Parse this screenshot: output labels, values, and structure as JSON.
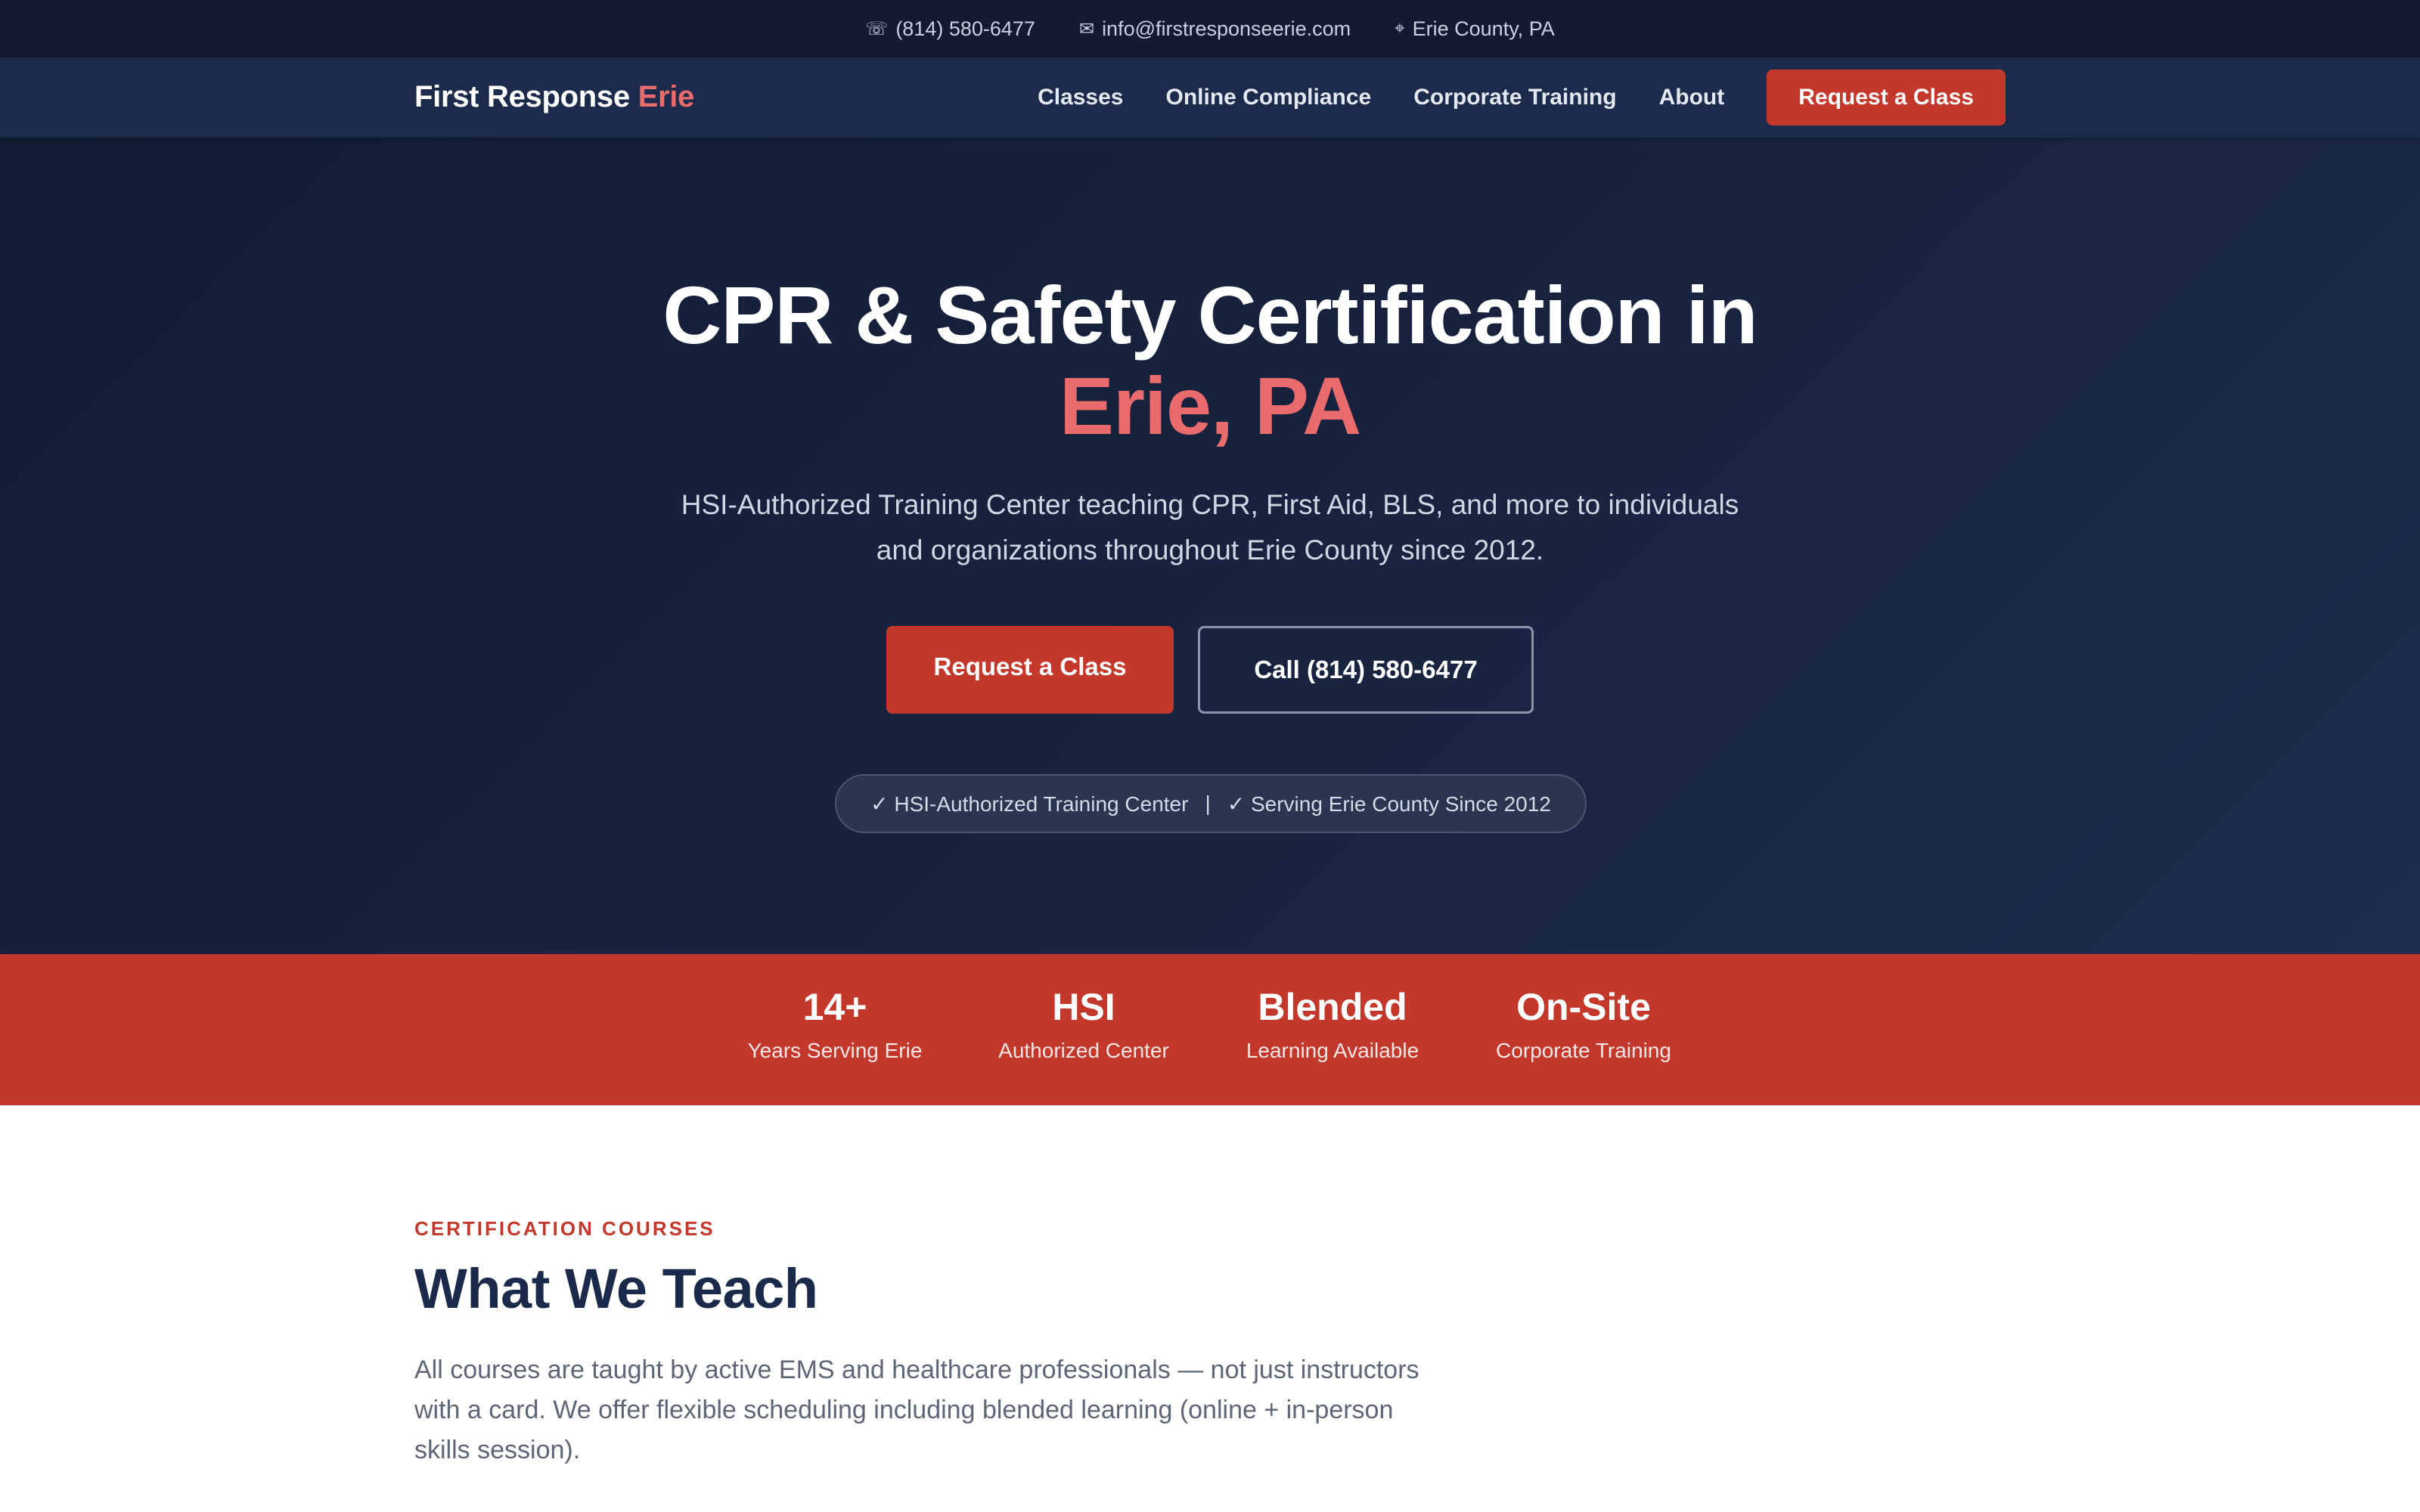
{
  "topbar": {
    "phone_icon": "phone-icon",
    "phone": "(814) 580-6477",
    "email_icon": "envelope-icon",
    "email": "info@firstresponseerie.com",
    "location_icon": "map-pin-icon",
    "location": "Erie County, PA"
  },
  "nav": {
    "brand_main": "First Response",
    "brand_accent": "Erie",
    "items": [
      {
        "label": "Classes"
      },
      {
        "label": "Online Compliance"
      },
      {
        "label": "Corporate Training"
      },
      {
        "label": "About"
      }
    ],
    "cta": "Request a Class"
  },
  "hero": {
    "title_line1": "CPR & Safety Certification in",
    "title_line2": "Erie, PA",
    "subtitle": "HSI-Authorized Training Center teaching CPR, First Aid, BLS, and more to individuals and organizations throughout Erie County since 2012.",
    "primary_button": "Request a Class",
    "secondary_button": "Call (814) 580-6477",
    "badge_left": "✓ HSI-Authorized Training Center",
    "badge_separator": "|",
    "badge_right": "✓ Serving Erie County Since 2012"
  },
  "stats": [
    {
      "value": "14+",
      "label": "Years Serving Erie"
    },
    {
      "value": "HSI",
      "label": "Authorized Center"
    },
    {
      "value": "Blended",
      "label": "Learning Available"
    },
    {
      "value": "On-Site",
      "label": "Corporate Training"
    }
  ],
  "courses": {
    "eyebrow": "CERTIFICATION COURSES",
    "heading": "What We Teach",
    "description": "All courses are taught by active EMS and healthcare professionals — not just instructors with a card. We offer flexible scheduling including blended learning (online + in-person skills session)."
  },
  "colors": {
    "accent_red": "#c4372b",
    "accent_pink": "#ea6b6b",
    "navy": "#1c2b4c",
    "dark_navy": "#121b32"
  }
}
